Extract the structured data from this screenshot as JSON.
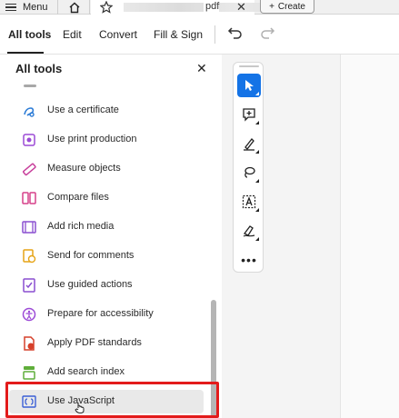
{
  "topbar": {
    "menu_label": "Menu",
    "tab_filename": "pdf",
    "create_label": "Create"
  },
  "toolbar": {
    "tabs": [
      "All tools",
      "Edit",
      "Convert",
      "Fill & Sign"
    ]
  },
  "panel": {
    "title": "All tools",
    "tools": [
      {
        "label": "Use a certificate",
        "icon": "certificate-icon"
      },
      {
        "label": "Use print production",
        "icon": "print-production-icon"
      },
      {
        "label": "Measure objects",
        "icon": "ruler-icon"
      },
      {
        "label": "Compare files",
        "icon": "compare-icon"
      },
      {
        "label": "Add rich media",
        "icon": "film-icon"
      },
      {
        "label": "Send for comments",
        "icon": "send-comments-icon"
      },
      {
        "label": "Use guided actions",
        "icon": "guided-actions-icon"
      },
      {
        "label": "Prepare for accessibility",
        "icon": "accessibility-icon"
      },
      {
        "label": "Apply PDF standards",
        "icon": "pdf-standards-icon"
      },
      {
        "label": "Add search index",
        "icon": "search-index-icon"
      },
      {
        "label": "Use JavaScript",
        "icon": "javascript-icon"
      }
    ]
  },
  "quick_tools": [
    "select-tool",
    "add-comment-tool",
    "highlight-tool",
    "draw-tool",
    "text-recognition-tool",
    "sign-tool",
    "more-tools"
  ],
  "colors": {
    "accent": "#1473e6",
    "highlight_box": "#e31b1b"
  }
}
